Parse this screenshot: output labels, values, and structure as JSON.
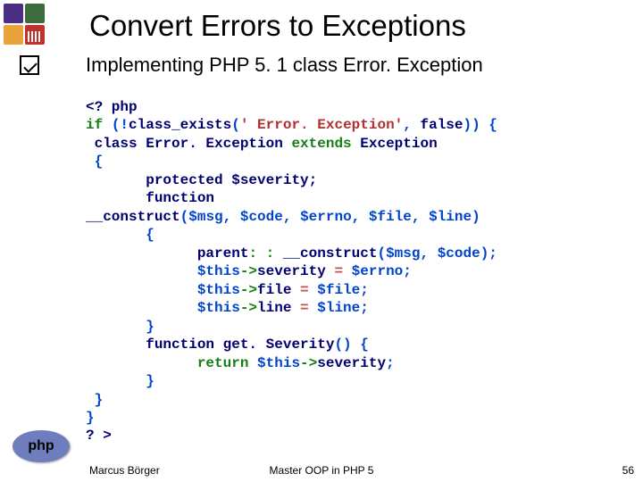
{
  "title": "Convert Errors to Exceptions",
  "subtitle": "Implementing PHP 5. 1 class Error. Exception",
  "php_logo": "php",
  "footer": {
    "author": "Marcus Börger",
    "center": "Master OOP in PHP 5",
    "page": "56"
  },
  "code": {
    "l01": "<? php",
    "l02_if": "if ",
    "l02_p1": "(!",
    "l02_fn": "class_exists",
    "l02_p2": "(",
    "l02_str": "' Error. Exception'",
    "l02_p3": ", ",
    "l02_false": "false",
    "l02_p4": ")) {",
    "l03_pre": " class Error. Exception ",
    "l03_ext": "extends",
    "l03_suf": " Exception",
    "l04": " {",
    "l05": "       protected $severity;",
    "l06": "       function ",
    "l07_fn": "__construct",
    "l07_p1": "(",
    "l07_v1": "$msg",
    "l07_c": ", ",
    "l07_v2": "$code",
    "l07_v3": "$errno",
    "l07_v4": "$file",
    "l07_v5": "$line",
    "l07_p2": ")",
    "l08": "       {",
    "l09_a": "             parent",
    "l09_b": ": : ",
    "l09_c": "__construct",
    "l09_p1": "(",
    "l09_v1": "$msg",
    "l09_cma": ", ",
    "l09_v2": "$code",
    "l09_p2": ");",
    "l10_a": "             $this",
    "l10_arr": "->",
    "l10_prop": "severity ",
    "l10_eq": "= ",
    "l10_b": "$errno",
    "l10_end": ";",
    "l11_prop": "file ",
    "l11_b": "$file",
    "l12_prop": "line ",
    "l12_b": "$line",
    "l13": "       }",
    "l14_a": "       function ",
    "l14_b": "get. Severity",
    "l14_c": "() {",
    "l15_a": "             return ",
    "l15_b": "$this",
    "l15_arr": "->",
    "l15_c": "severity",
    "l15_d": ";",
    "l16": "       }",
    "l17": " }",
    "l18": "}",
    "l19": "? >"
  }
}
